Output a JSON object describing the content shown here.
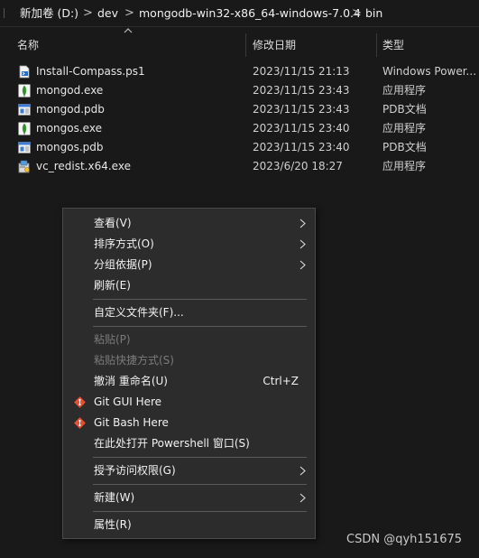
{
  "address_bar": {
    "segments": [
      "新加卷 (D:)",
      "dev",
      "mongodb-win32-x86_64-windows-7.0.4",
      "bin"
    ],
    "separator": ">"
  },
  "columns": {
    "name": "名称",
    "date_modified": "修改日期",
    "type": "类型"
  },
  "files": [
    {
      "name": "Install-Compass.ps1",
      "date": "2023/11/15 21:13",
      "type": "Windows Power...",
      "icon": "powershell-script-icon"
    },
    {
      "name": "mongod.exe",
      "date": "2023/11/15 23:43",
      "type": "应用程序",
      "icon": "mongodb-leaf-icon"
    },
    {
      "name": "mongod.pdb",
      "date": "2023/11/15 23:43",
      "type": "PDB文档",
      "icon": "pdb-document-icon"
    },
    {
      "name": "mongos.exe",
      "date": "2023/11/15 23:40",
      "type": "应用程序",
      "icon": "mongodb-leaf-icon"
    },
    {
      "name": "mongos.pdb",
      "date": "2023/11/15 23:40",
      "type": "PDB文档",
      "icon": "pdb-document-icon"
    },
    {
      "name": "vc_redist.x64.exe",
      "date": "2023/6/20 18:27",
      "type": "应用程序",
      "icon": "installer-icon"
    }
  ],
  "context_menu": {
    "view": "查看(V)",
    "sort_by": "排序方式(O)",
    "group_by": "分组依据(P)",
    "refresh": "刷新(E)",
    "customize_folder": "自定义文件夹(F)...",
    "paste": "粘贴(P)",
    "paste_shortcut": "粘贴快捷方式(S)",
    "undo_rename": "撤消 重命名(U)",
    "undo_shortcut": "Ctrl+Z",
    "git_gui": "Git GUI Here",
    "git_bash": "Git Bash Here",
    "open_powershell": "在此处打开 Powershell 窗口(S)",
    "grant_access": "授予访问权限(G)",
    "new": "新建(W)",
    "properties": "属性(R)"
  },
  "colors": {
    "background": "#191919",
    "menu_background": "#2c2c2c",
    "disabled_text": "#7b7b7b",
    "mongodb_green": "#3fa037",
    "git_red": "#e84e31"
  },
  "watermark": "CSDN @qyh151675"
}
